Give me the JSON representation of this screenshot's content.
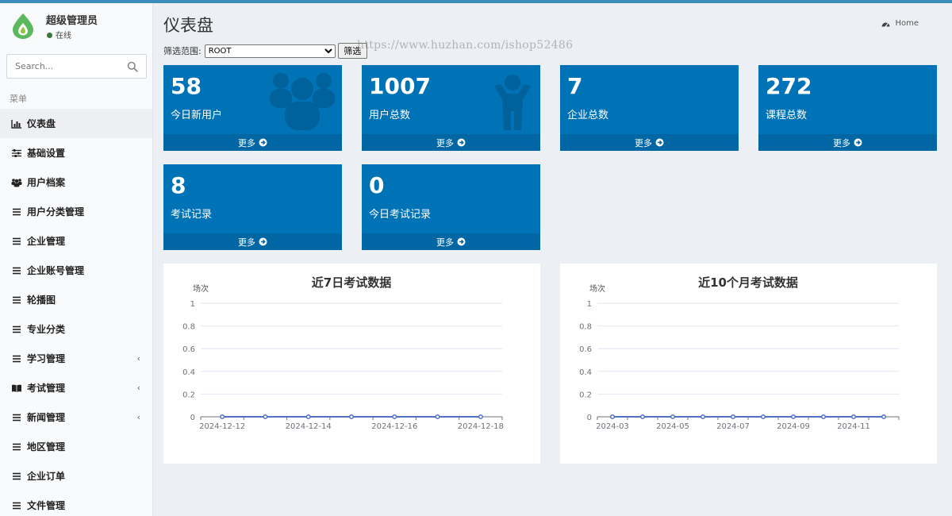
{
  "app": {
    "user_name": "超级管理员",
    "user_status": "在线",
    "search_placeholder": "Search...",
    "menu_header": "菜单"
  },
  "menu": [
    {
      "label": "仪表盘",
      "icon": "bar-chart-icon",
      "active": true
    },
    {
      "label": "基础设置",
      "icon": "sliders-icon"
    },
    {
      "label": "用户档案",
      "icon": "users-icon"
    },
    {
      "label": "用户分类管理",
      "icon": "list-icon"
    },
    {
      "label": "企业管理",
      "icon": "list-icon"
    },
    {
      "label": "企业账号管理",
      "icon": "list-icon"
    },
    {
      "label": "轮播图",
      "icon": "list-icon"
    },
    {
      "label": "专业分类",
      "icon": "list-icon"
    },
    {
      "label": "学习管理",
      "icon": "list-icon",
      "caret": "‹"
    },
    {
      "label": "考试管理",
      "icon": "book-icon",
      "caret": "‹"
    },
    {
      "label": "新闻管理",
      "icon": "list-icon",
      "caret": "‹"
    },
    {
      "label": "地区管理",
      "icon": "list-icon"
    },
    {
      "label": "企业订单",
      "icon": "list-icon"
    },
    {
      "label": "文件管理",
      "icon": "list-icon"
    }
  ],
  "header": {
    "page_title": "仪表盘",
    "breadcrumb": "Home"
  },
  "filter": {
    "label": "筛选范围:",
    "selected": "ROOT",
    "button": "筛选"
  },
  "watermark": "https://www.huzhan.com/ishop52486",
  "stats": [
    {
      "value": "58",
      "label": "今日新用户",
      "more": "更多",
      "icon": "users-icon"
    },
    {
      "value": "1007",
      "label": "用户总数",
      "more": "更多",
      "icon": "user-icon"
    },
    {
      "value": "7",
      "label": "企业总数",
      "more": "更多"
    },
    {
      "value": "272",
      "label": "课程总数",
      "more": "更多"
    },
    {
      "value": "8",
      "label": "考试记录",
      "more": "更多"
    },
    {
      "value": "0",
      "label": "今日考试记录",
      "more": "更多"
    }
  ],
  "colors": {
    "accent": "#3c8dbc",
    "stat_box": "#0073b7",
    "stat_footer": "#0067a4",
    "line": "#5470c6"
  },
  "chart_data": [
    {
      "type": "line",
      "title": "近7日考试数据",
      "ylabel": "场次",
      "ylim": [
        0,
        1
      ],
      "yticks": [
        "0",
        "0.2",
        "0.4",
        "0.6",
        "0.8",
        "1"
      ],
      "x": [
        "2024-12-12",
        "2024-12-13",
        "2024-12-14",
        "2024-12-15",
        "2024-12-16",
        "2024-12-17",
        "2024-12-18"
      ],
      "x_tick_labels": [
        "2024-12-12",
        "2024-12-14",
        "2024-12-16",
        "2024-12-18"
      ],
      "series": [
        {
          "values": [
            0,
            0,
            0,
            0,
            0,
            0,
            0
          ]
        }
      ]
    },
    {
      "type": "line",
      "title": "近10个月考试数据",
      "ylabel": "场次",
      "ylim": [
        0,
        1
      ],
      "yticks": [
        "0",
        "0.2",
        "0.4",
        "0.6",
        "0.8",
        "1"
      ],
      "x": [
        "2024-03",
        "2024-04",
        "2024-05",
        "2024-06",
        "2024-07",
        "2024-08",
        "2024-09",
        "2024-10",
        "2024-11",
        "2024-12"
      ],
      "x_tick_labels": [
        "2024-03",
        "2024-05",
        "2024-07",
        "2024-09",
        "2024-11"
      ],
      "series": [
        {
          "values": [
            0,
            0,
            0,
            0,
            0,
            0,
            0,
            0,
            0,
            0
          ]
        }
      ]
    }
  ]
}
